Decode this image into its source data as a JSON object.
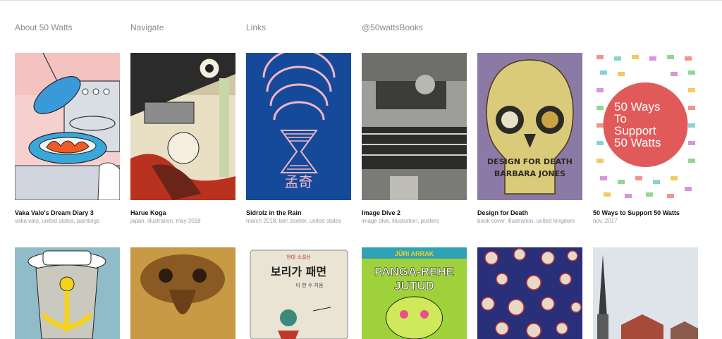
{
  "nav": {
    "items": [
      {
        "label": "About 50 Watts"
      },
      {
        "label": "Navigate"
      },
      {
        "label": "Links"
      },
      {
        "label": "@50wattsBooks"
      }
    ]
  },
  "posts": [
    {
      "title": "Vaka Valo's Dream Diary 3",
      "meta": "vaka valo, united states, paintings"
    },
    {
      "title": "Harue Koga",
      "meta": "japan, illustration, may 2018"
    },
    {
      "title": "Sidrolz in the Rain",
      "meta": "march 2018, ben zoeller, united states"
    },
    {
      "title": "Image Dive 2",
      "meta": "image dive, illustration, posters"
    },
    {
      "title": "Design for Death",
      "meta": "book cover, illustration, united kingdom"
    },
    {
      "title": "50 Ways to Support 50 Watts",
      "meta": "nov. 2017"
    }
  ],
  "images": {
    "sidrolz_glyph": "孟奇",
    "death_cover_line1": "DESIGN FOR DEATH",
    "death_cover_line2": "BARBARA JONES",
    "ways_line1": "50 Ways",
    "ways_line2": "To",
    "ways_line3": "Support",
    "ways_line4": "50 Watts",
    "korean_book_small": "현대 소설선",
    "korean_book_title": "보리가 패면",
    "korean_book_author": "이 한 수 지음",
    "estonian_author": "JÜRI ARRAK",
    "estonian_title1": "PANGA-REHE",
    "estonian_title2": "JUTUD"
  }
}
